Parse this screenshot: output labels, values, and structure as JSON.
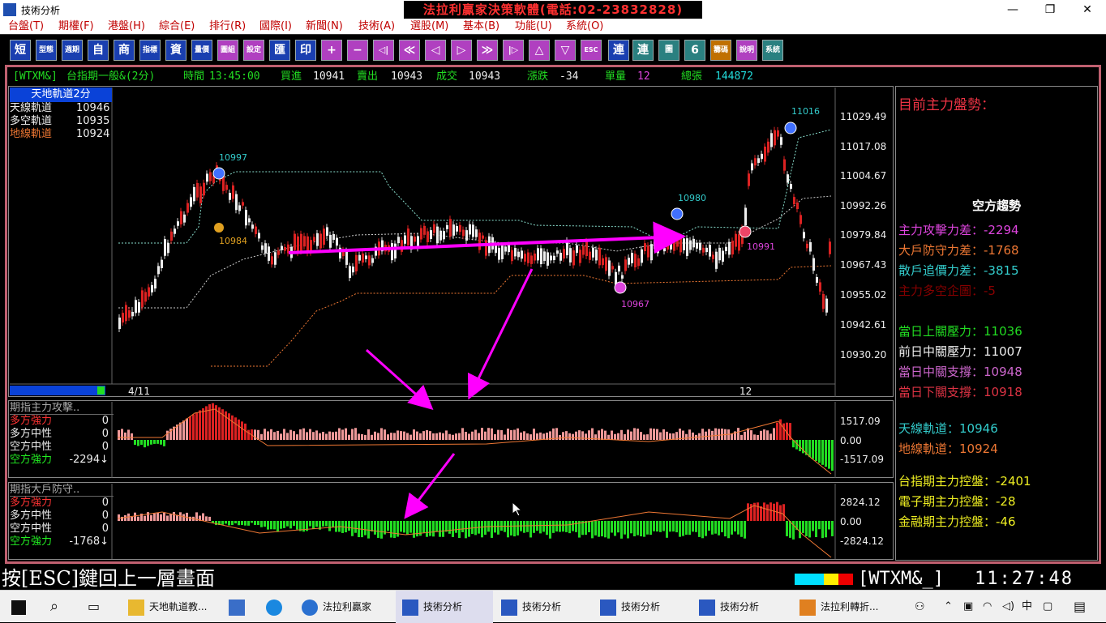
{
  "window": {
    "title": "技術分析",
    "banner": "法拉利贏家決策軟體(電話:02-23832828)",
    "min": "—",
    "max": "❐",
    "close": "✕"
  },
  "menu": [
    "台盤(T)",
    "期權(F)",
    "港盤(H)",
    "綜合(E)",
    "排行(R)",
    "國際(I)",
    "新聞(N)",
    "技術(A)",
    "選股(M)",
    "基本(B)",
    "功能(U)",
    "系統(O)"
  ],
  "toolbar": [
    "短",
    "型態",
    "週期",
    "自",
    "商",
    "指標",
    "資",
    "量價",
    "圖組",
    "設定",
    "匯",
    "印",
    "+",
    "−",
    "◁|",
    "≪",
    "◁",
    "▷",
    "≫",
    "|▷",
    "△",
    "▽",
    "ESC",
    "連",
    "連",
    "圖",
    "6",
    "籌碼",
    "說明",
    "系統"
  ],
  "info": {
    "symbol": "[WTXM&]",
    "name": "台指期一般&(2分)",
    "time_label": "時間",
    "time": "13:45:00",
    "bid_label": "買進",
    "bid": "10941",
    "ask_label": "賣出",
    "ask": "10943",
    "trade_label": "成交",
    "trade": "10943",
    "chg_label": "漲跌",
    "chg": "-34",
    "vol_label": "單量",
    "vol": "12",
    "total_label": "總張",
    "total": "144872"
  },
  "main_legend": {
    "title": "天地軌道2分",
    "rows": [
      {
        "label": "天線軌道",
        "value": "10946"
      },
      {
        "label": "多空軌道",
        "value": "10935"
      },
      {
        "label": "地線軌道",
        "value": "10924"
      }
    ]
  },
  "y_axis_main": [
    "11029.49",
    "11017.08",
    "11004.67",
    "10992.26",
    "10979.84",
    "10967.43",
    "10955.02",
    "10942.61",
    "10930.20"
  ],
  "x_axis_main": [
    "4/11",
    "12"
  ],
  "annotations": [
    "10997",
    "10984",
    "10980",
    "10967",
    "10991",
    "11016"
  ],
  "sub1": {
    "title": "期指主力攻擊..",
    "rows": [
      {
        "label": "多方強力",
        "value": "0"
      },
      {
        "label": "多方中性",
        "value": "0"
      },
      {
        "label": "空方中性",
        "value": "0"
      },
      {
        "label": "空方強力",
        "value": "-2294↓"
      }
    ],
    "y_axis": [
      "1517.09",
      "0.00",
      "-1517.09"
    ]
  },
  "sub2": {
    "title": "期指大戶防守..",
    "rows": [
      {
        "label": "多方強力",
        "value": "0"
      },
      {
        "label": "多方中性",
        "value": "0"
      },
      {
        "label": "空方中性",
        "value": "0"
      },
      {
        "label": "空方強力",
        "value": "-1768↓"
      }
    ],
    "y_axis": [
      "2824.12",
      "0.00",
      "-2824.12"
    ]
  },
  "right_panel": {
    "heading": "目前主力盤勢：",
    "trend": "空方趨勢",
    "lines": [
      {
        "label": "主力攻擊力差：",
        "value": "-2294",
        "color": "#dd44dd"
      },
      {
        "label": "大戶防守力差：",
        "value": "-1768",
        "color": "#ee7733"
      },
      {
        "label": "散戶追價力差：",
        "value": "-3815",
        "color": "#33cccc"
      },
      {
        "label": "主力多空企圖：",
        "value": "-5",
        "color": "#880000"
      },
      {
        "label": "當日上關壓力：",
        "value": "11036",
        "color": "#22dd22"
      },
      {
        "label": "前日中關壓力：",
        "value": "11007",
        "color": "#eeeeee"
      },
      {
        "label": "當日中關支撐：",
        "value": "10948",
        "color": "#cc66cc"
      },
      {
        "label": "當日下關支撐：",
        "value": "10918",
        "color": "#dd3344"
      },
      {
        "label": "天線軌道：",
        "value": "10946",
        "color": "#33cccc"
      },
      {
        "label": "地線軌道：",
        "value": "10924",
        "color": "#ee7733"
      },
      {
        "label": "台指期主力控盤：",
        "value": "-2401",
        "color": "#eeee22"
      },
      {
        "label": "電子期主力控盤：",
        "value": "-28",
        "color": "#eeee22"
      },
      {
        "label": "金融期主力控盤：",
        "value": "-46",
        "color": "#eeee22"
      }
    ]
  },
  "status": {
    "esc_text": "按[ESC]鍵回上一層畫面",
    "code": "[WTXM&_]",
    "clock": "11:27:48"
  },
  "taskbar": {
    "items": [
      "天地軌道教...",
      "",
      "",
      "法拉利贏家",
      "技術分析",
      "技術分析",
      "技術分析",
      "技術分析",
      "法拉利轉折..."
    ],
    "ime": "中"
  },
  "colors": {
    "accent": "#ff00ff",
    "frame": "#c06070",
    "up": "#dd2222",
    "down": "#22cc22"
  }
}
